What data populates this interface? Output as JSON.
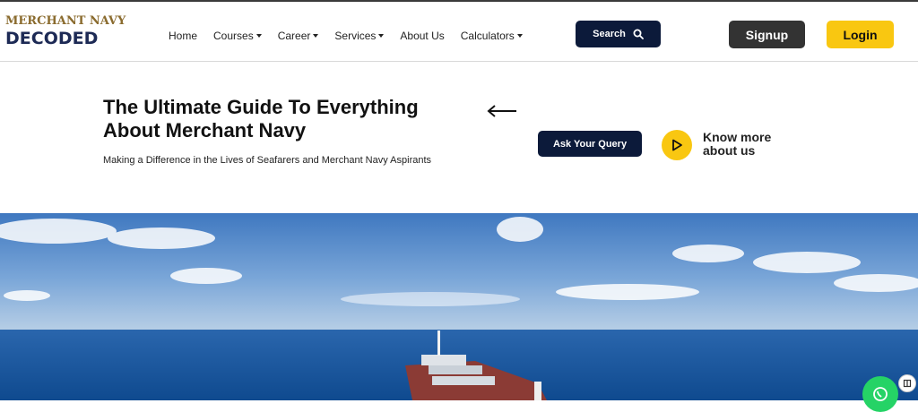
{
  "logo": {
    "line1": "MERCHANT NAVY",
    "line2": "DECODED"
  },
  "nav": {
    "items": [
      {
        "label": "Home",
        "dropdown": false
      },
      {
        "label": "Courses",
        "dropdown": true
      },
      {
        "label": "Career",
        "dropdown": true
      },
      {
        "label": "Services",
        "dropdown": true
      },
      {
        "label": "About Us",
        "dropdown": false
      },
      {
        "label": "Calculators",
        "dropdown": true
      }
    ]
  },
  "header": {
    "search_label": "Search",
    "signup_label": "Signup",
    "login_label": "Login"
  },
  "hero": {
    "title": "The Ultimate Guide To Everything About Merchant Navy",
    "subtitle": "Making a Difference in the Lives of Seafarers and Merchant Navy Aspirants",
    "query_label": "Ask Your Query",
    "know_more_label": "Know more about us"
  },
  "colors": {
    "navy": "#0c1a3a",
    "yellow": "#f9c711",
    "dark": "#333333",
    "whatsapp": "#25d366"
  }
}
